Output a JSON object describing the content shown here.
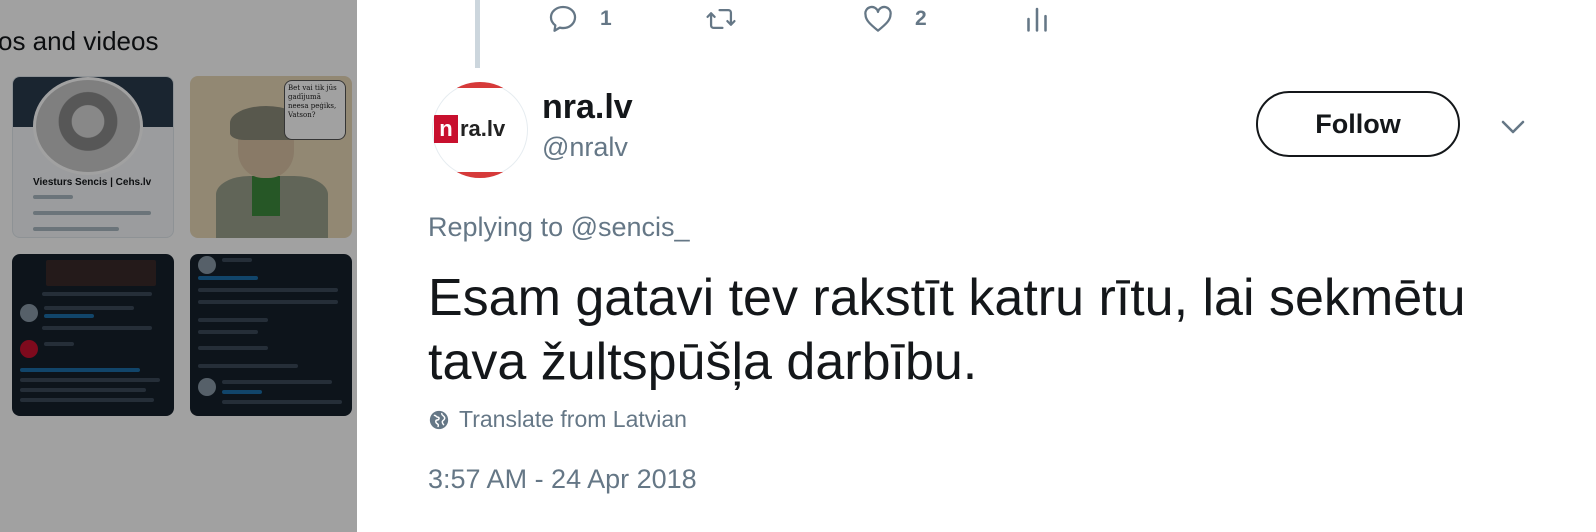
{
  "media_panel": {
    "title": "os and videos",
    "thumb1": {
      "name": "Viesturs Sencis | Cehs.lv"
    },
    "thumb2": {
      "bubble_text": "Bet vai tik jūs gadījumā neesa peģiks, Vatson?"
    }
  },
  "action_bar": {
    "reply_icon": "reply-icon",
    "reply_count": "1",
    "retweet_icon": "retweet-icon",
    "like_icon": "heart-icon",
    "like_count": "2",
    "analytics_icon": "analytics-icon"
  },
  "tweet": {
    "avatar_logo_n": "n",
    "avatar_logo_rest": "ra.lv",
    "display_name": "nra.lv",
    "handle": "@nralv",
    "follow_label": "Follow",
    "replying_to": "Replying to @sencis_",
    "text": "Esam gatavi tev rakstīt katru rītu, lai sekmētu tava žultspūšļa darbību.",
    "translate_label": "Translate from Latvian",
    "timestamp": "3:57 AM - 24 Apr 2018"
  },
  "colors": {
    "text_primary": "#14171a",
    "text_secondary": "#657786",
    "brand_red": "#c8102e"
  }
}
